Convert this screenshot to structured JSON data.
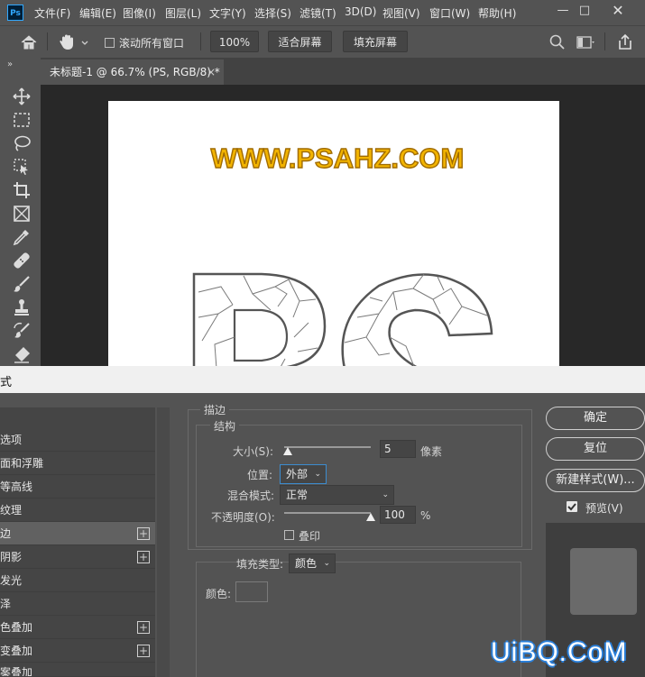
{
  "app": {
    "logo": "Ps"
  },
  "menu": [
    "文件(F)",
    "编辑(E)",
    "图像(I)",
    "图层(L)",
    "文字(Y)",
    "选择(S)",
    "滤镜(T)",
    "3D(D)",
    "视图(V)",
    "窗口(W)",
    "帮助(H)"
  ],
  "options": {
    "scroll_all": "滚动所有窗口",
    "zoom": "100%",
    "fit_screen": "适合屏幕",
    "fill_screen": "填充屏幕"
  },
  "doc_tab": {
    "title": "未标题-1 @ 66.7% (PS, RGB/8) *",
    "close": "×"
  },
  "canvas": {
    "headline": "WWW.PSAHZ.COM",
    "big_text": "PS",
    "headline_color": "#f2b400",
    "headline_stroke": "#a06b00"
  },
  "dialog": {
    "title_fragment": "式",
    "styles": [
      {
        "label": "选项",
        "plus": false
      },
      {
        "label": "斜面和浮雕",
        "plus": false
      },
      {
        "label": "等高线",
        "plus": false
      },
      {
        "label": "纹理",
        "plus": false
      },
      {
        "label": "描边",
        "plus": true,
        "selected": true
      },
      {
        "label": "内阴影",
        "plus": true
      },
      {
        "label": "内发光",
        "plus": false
      },
      {
        "label": "光泽",
        "plus": false
      },
      {
        "label": "颜色叠加",
        "plus": true
      },
      {
        "label": "渐变叠加",
        "plus": true
      },
      {
        "label": "图案叠加",
        "plus": false
      }
    ],
    "styles_visible": [
      "选项",
      "面和浮雕",
      "等高线",
      "纹理",
      "边",
      "阴影",
      "发光",
      "泽",
      "色叠加",
      "变叠加",
      "案叠加"
    ],
    "stroke": {
      "section_title": "描边",
      "structure_title": "结构",
      "size_label": "大小(S):",
      "size_value": "5",
      "size_unit": "像素",
      "size_fraction": 0.0,
      "position_label": "位置:",
      "position_value": "外部",
      "blend_label": "混合模式:",
      "blend_value": "正常",
      "opacity_label": "不透明度(O):",
      "opacity_value": "100",
      "opacity_unit": "%",
      "opacity_fraction": 1.0,
      "overprint_label": "叠印",
      "fill_type_label": "填充类型:",
      "fill_type_value": "颜色",
      "color_label": "颜色:",
      "stroke_color": "#535353"
    },
    "buttons": {
      "ok": "确定",
      "reset": "复位",
      "new_style": "新建样式(W)...",
      "preview": "预览(V)"
    }
  },
  "watermark": "UiBQ.CoM"
}
